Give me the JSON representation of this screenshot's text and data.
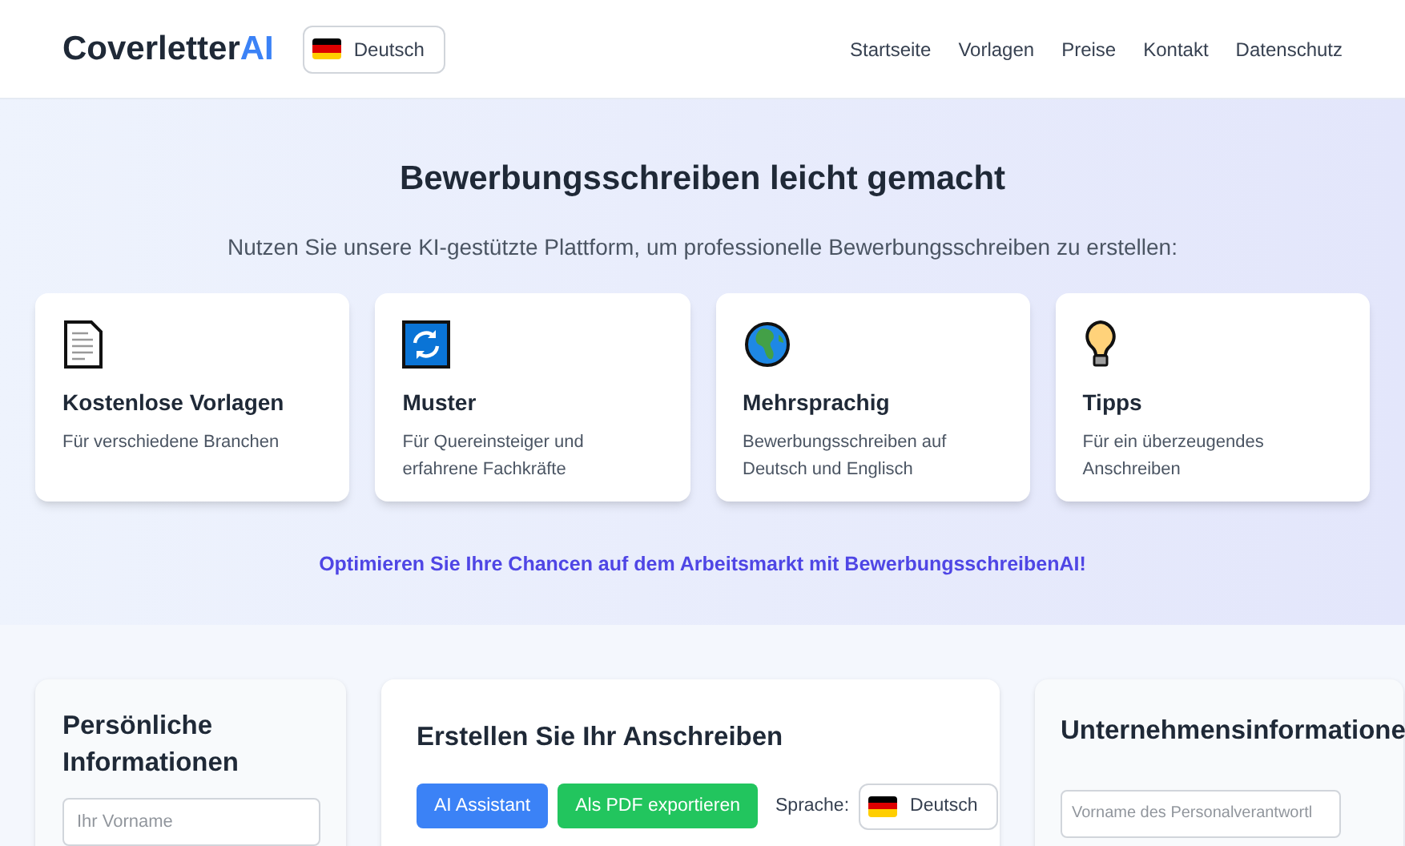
{
  "header": {
    "logo": {
      "main": "Coverletter",
      "accent": "AI"
    },
    "language": "Deutsch",
    "nav": [
      "Startseite",
      "Vorlagen",
      "Preise",
      "Kontakt",
      "Datenschutz"
    ]
  },
  "hero": {
    "title": "Bewerbungsschreiben leicht gemacht",
    "subtitle": "Nutzen Sie unsere KI-gestützte Plattform, um professionelle Bewerbungsschreiben zu erstellen:",
    "features": [
      {
        "kind": "document",
        "title": "Kostenlose Vorlagen",
        "text": "Für verschiedene Branchen"
      },
      {
        "kind": "refresh",
        "title": "Muster",
        "text": "Für Quereinsteiger und erfahrene Fachkräfte"
      },
      {
        "kind": "globe",
        "title": "Mehrsprachig",
        "text": "Bewerbungsschreiben auf Deutsch und Englisch"
      },
      {
        "kind": "bulb",
        "title": "Tipps",
        "text": "Für ein überzeugendes Anschreiben"
      }
    ],
    "cta": "Optimieren Sie Ihre Chancen auf dem Arbeitsmarkt mit BewerbungsschreibenAI!"
  },
  "personal": {
    "title": "Persönliche Informationen",
    "field": {
      "placeholder": "Ihr Vorname"
    }
  },
  "editor": {
    "title": "Erstellen Sie Ihr Anschreiben",
    "buttons": [
      {
        "kind": "primary",
        "label": "AI Assistant"
      },
      {
        "kind": "success",
        "label": "Als PDF exportieren"
      }
    ],
    "language_label": "Sprache:",
    "language": "Deutsch"
  },
  "company": {
    "title": "Unternehmensinformatione",
    "field": {
      "placeholder": "Vorname des Personalverantwortl"
    }
  }
}
